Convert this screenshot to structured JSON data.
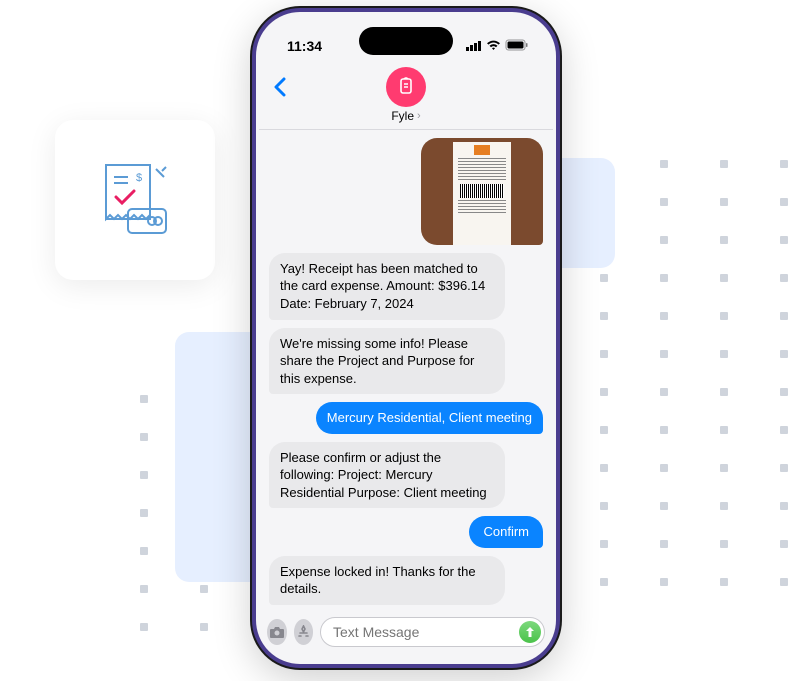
{
  "status": {
    "time": "11:34"
  },
  "header": {
    "name": "Fyle"
  },
  "messages": {
    "m1": "Yay! Receipt has been matched to the card expense. Amount: $396.14 Date: February 7, 2024",
    "m2": "We're missing some info! Please share the Project and Purpose for this expense.",
    "m3": "Mercury Residential, Client meeting",
    "m4": "Please confirm or adjust the following: Project: Mercury Residential Purpose: Client meeting",
    "m5": "Confirm",
    "m6": "Expense locked in! Thanks for the details."
  },
  "input": {
    "placeholder": "Text Message"
  }
}
